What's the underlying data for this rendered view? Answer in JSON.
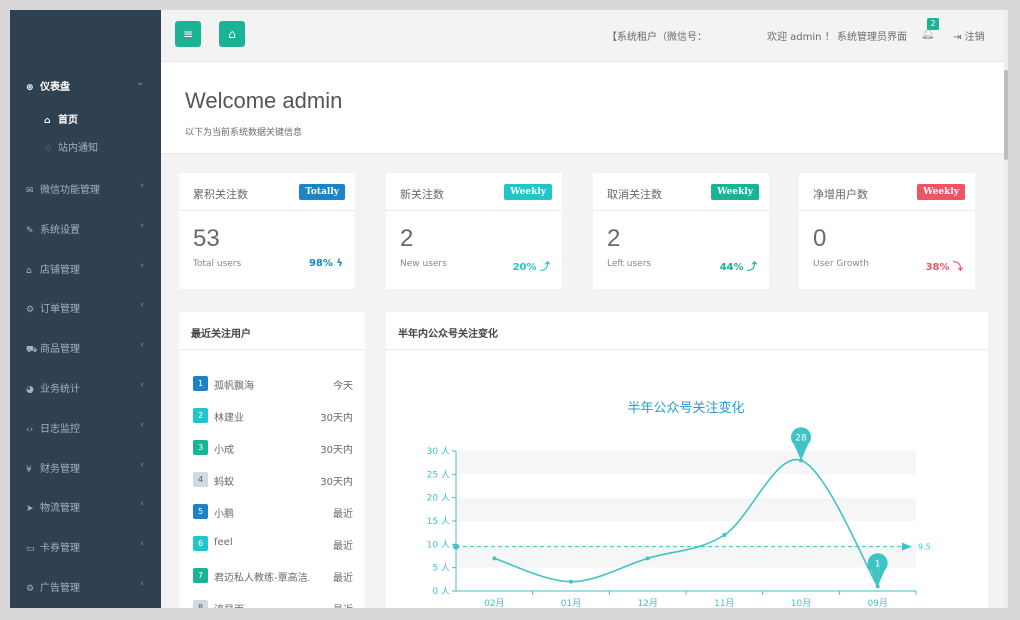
{
  "sidebar": {
    "group": {
      "label": "仪表盘",
      "icon": "dashboard-icon"
    },
    "sub_items": [
      {
        "label": "首页",
        "icon": "home-icon"
      },
      {
        "label": "站内通知",
        "icon": "bell-icon"
      }
    ],
    "items": [
      {
        "label": "微信功能管理",
        "icon": "wechat-icon"
      },
      {
        "label": "系统设置",
        "icon": "wrench-icon"
      },
      {
        "label": "店铺管理",
        "icon": "home-icon"
      },
      {
        "label": "订单管理",
        "icon": "cogs-icon"
      },
      {
        "label": "商品管理",
        "icon": "cart-icon"
      },
      {
        "label": "业务统计",
        "icon": "pie-chart-icon"
      },
      {
        "label": "日志监控",
        "icon": "code-icon"
      },
      {
        "label": "财务管理",
        "icon": "yen-icon"
      },
      {
        "label": "物流管理",
        "icon": "send-icon"
      },
      {
        "label": "卡券管理",
        "icon": "card-icon"
      },
      {
        "label": "广告管理",
        "icon": "cog-icon"
      }
    ]
  },
  "topbar": {
    "account": "【系统租户（微信号：",
    "greeting": "欢迎 admin ！",
    "admin_link": "系统管理员界面",
    "notify_count": "2",
    "logout": "注销"
  },
  "welcome": {
    "title": "Welcome admin",
    "subtitle": "以下为当前系统数据关键信息"
  },
  "stats": [
    {
      "title": "累积关注数",
      "tag": "Totally",
      "tag_color": "#1c84c6",
      "value": "53",
      "sub": "Total users",
      "pct": "98%",
      "pct_color": "#1c84c6",
      "arrow": "ϟ"
    },
    {
      "title": "新关注数",
      "tag": "Weekly",
      "tag_color": "#23c6c8",
      "value": "2",
      "sub": "New users",
      "pct": "20%",
      "pct_color": "#23c6c8",
      "arrow": "⤴"
    },
    {
      "title": "取消关注数",
      "tag": "Weekly",
      "tag_color": "#1ab394",
      "value": "2",
      "sub": "Left users",
      "pct": "44%",
      "pct_color": "#1ab394",
      "arrow": "⤴"
    },
    {
      "title": "净增用户数",
      "tag": "Weekly",
      "tag_color": "#ed5565",
      "value": "0",
      "sub": "User Growth",
      "pct": "38%",
      "pct_color": "#ed5565",
      "arrow": "⤵"
    }
  ],
  "recent": {
    "title": "最近关注用户",
    "users": [
      {
        "rank": "1",
        "name": "孤帆飘海",
        "time": "今天",
        "color": "#1c84c6"
      },
      {
        "rank": "2",
        "name": "林建业",
        "time": "30天内",
        "color": "#23c6c8"
      },
      {
        "rank": "3",
        "name": "小成",
        "time": "30天内",
        "color": "#1ab394"
      },
      {
        "rank": "4",
        "name": "蚂蚁",
        "time": "30天内",
        "color": "#d1dade"
      },
      {
        "rank": "5",
        "name": "小鹏",
        "time": "最近",
        "color": "#1c84c6"
      },
      {
        "rank": "6",
        "name": "feel",
        "time": "最近",
        "color": "#23c6c8"
      },
      {
        "rank": "7",
        "name": "君迈私人教练-覃高洁二",
        "time": "最近",
        "color": "#1ab394"
      },
      {
        "rank": "8",
        "name": "流星雨",
        "time": "最近",
        "color": "#d1dade"
      }
    ]
  },
  "chart_panel": {
    "title": "半年内公众号关注变化"
  },
  "chart_data": {
    "type": "line",
    "title": "半年公众号关注变化",
    "categories": [
      "02月",
      "01月",
      "12月",
      "11月",
      "10月",
      "09月"
    ],
    "series": [
      {
        "values": [
          7,
          2,
          7,
          12,
          28,
          1
        ]
      }
    ],
    "yticks": [
      "0 人",
      "5 人",
      "10 人",
      "15 人",
      "20 人",
      "25 人",
      "30 人"
    ],
    "ylim": [
      0,
      30
    ],
    "average": 9.5,
    "average_label": "9.5",
    "max_label": "28",
    "min_label": "1",
    "color": "#3fc4c4"
  }
}
